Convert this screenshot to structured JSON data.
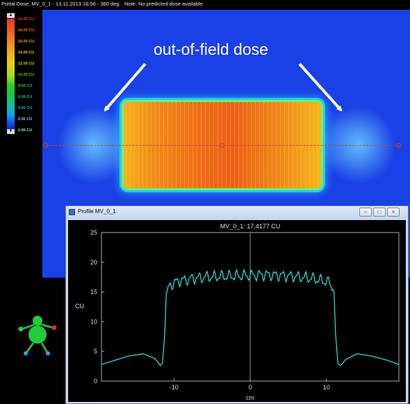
{
  "status_bar": {
    "left": "Portal Dose: MV_0_1 - 13.11.2013 16:56 - 360 deg",
    "right": "Note: No predicted dose available"
  },
  "color_scale": {
    "labels": [
      {
        "text": "19.58 CU",
        "color": "#e8303a"
      },
      {
        "text": "18.00 CU",
        "color": "#ef6a26"
      },
      {
        "text": "16.00 CU",
        "color": "#f39a1c"
      },
      {
        "text": "14.00 CU",
        "color": "#f2c81a"
      },
      {
        "text": "12.00 CU",
        "color": "#b8e01a"
      },
      {
        "text": "10.00 CU",
        "color": "#3ed21c"
      },
      {
        "text": "8.00 CU",
        "color": "#18c850"
      },
      {
        "text": "6.00 CU",
        "color": "#14c0a0"
      },
      {
        "text": "4.00 CU",
        "color": "#15a6e6"
      },
      {
        "text": "2.00 CU",
        "color": "#8fc8ff"
      },
      {
        "text": "0.00 CU",
        "color": "#9ae0a0"
      }
    ]
  },
  "annotation": {
    "text": "out-of-field dose"
  },
  "profile_window": {
    "title": "Profile MV_0_1",
    "plot_title": "MV_0_1: 17.4177 CU",
    "buttons": {
      "minimize": "–",
      "maximize": "□",
      "close": "×"
    }
  },
  "chart_data": {
    "type": "line",
    "title": "MV_0_1: 17.4177 CU",
    "xlabel": "cm",
    "ylabel": "CU",
    "xlim": [
      -19.5,
      19.5
    ],
    "ylim": [
      0,
      25
    ],
    "xticks": [
      -10,
      0,
      10
    ],
    "yticks": [
      0,
      5,
      10,
      15,
      20,
      25
    ],
    "grid": false,
    "line_color": "#2fe6e0",
    "x": [
      -19.5,
      -18,
      -16,
      -14,
      -12.5,
      -12,
      -11.8,
      -11.5,
      -11.2,
      -11.0,
      -10.5,
      -9.5,
      -8,
      -6,
      -4,
      -2,
      0,
      2,
      4,
      6,
      8,
      9.5,
      10.5,
      11.0,
      11.2,
      11.5,
      11.8,
      12,
      12.5,
      14,
      16,
      18,
      19.5
    ],
    "y": [
      2.8,
      3.4,
      4.2,
      4.6,
      3.8,
      3.0,
      2.6,
      3.0,
      8.0,
      14.8,
      16.2,
      16.8,
      17.2,
      17.5,
      17.6,
      17.7,
      17.8,
      17.9,
      17.8,
      17.6,
      17.3,
      16.9,
      16.5,
      15.0,
      8.0,
      3.0,
      2.6,
      2.8,
      3.6,
      4.6,
      4.2,
      3.5,
      2.8
    ]
  }
}
